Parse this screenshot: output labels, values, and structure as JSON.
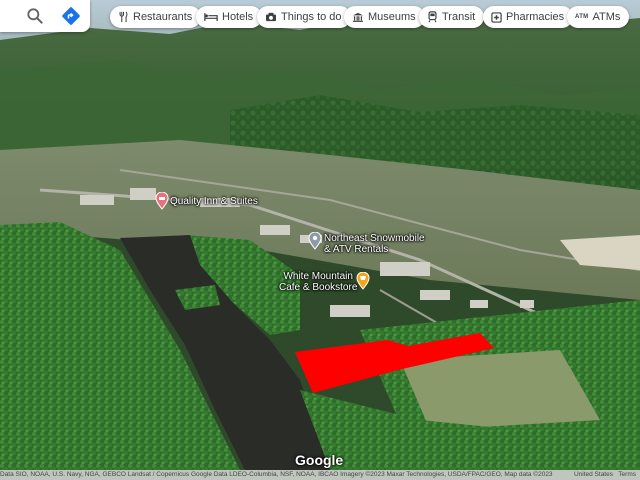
{
  "search": {
    "search_icon": "search-icon",
    "directions_icon": "directions-icon"
  },
  "chips": [
    {
      "label": "Restaurants",
      "icon": "fork-knife-icon"
    },
    {
      "label": "Hotels",
      "icon": "bed-icon"
    },
    {
      "label": "Things to do",
      "icon": "camera-icon"
    },
    {
      "label": "Museums",
      "icon": "museum-icon"
    },
    {
      "label": "Transit",
      "icon": "train-icon"
    },
    {
      "label": "Pharmacies",
      "icon": "pharmacy-icon"
    },
    {
      "label": "ATMs",
      "icon": "atm-icon",
      "icon_text": "ATM"
    }
  ],
  "places": [
    {
      "name": "Quality Inn & Suites",
      "color": "#e7717d"
    },
    {
      "name_line1": "Northeast Snowmobile",
      "name_line2": "& ATV Rentals",
      "color": "#8e9aa8"
    },
    {
      "name_line1": "White Mountain",
      "name_line2": "Cafe & Bookstore",
      "color": "#f2a71b"
    }
  ],
  "highlight": {
    "color": "#ff0000"
  },
  "footer": {
    "logo": "Google",
    "attribution": "Data SIO, NOAA, U.S. Navy, NGA, GEBCO Landsat / Copernicus Google Data LDEO-Columbia, NSF, NOAA, IBCAO Imagery ©2023 Maxar Technologies, USDA/FPAC/GEO, Map data ©2023",
    "country": "United States",
    "terms": "Terms"
  }
}
